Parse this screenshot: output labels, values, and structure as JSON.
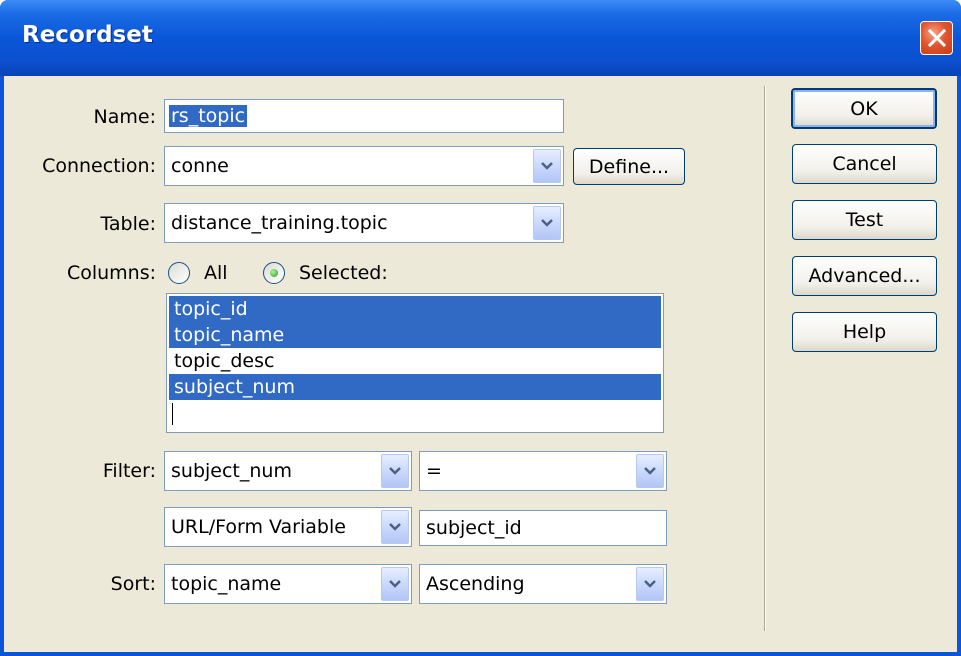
{
  "dialog": {
    "title": "Recordset"
  },
  "form": {
    "name_label": "Name:",
    "name_value": "rs_topic",
    "connection_label": "Connection:",
    "connection_value": "conne",
    "define_button": "Define...",
    "table_label": "Table:",
    "table_value": "distance_training.topic",
    "columns_label": "Columns:",
    "radio_all": "All",
    "radio_selected": "Selected:",
    "columns_selected_option": "Selected",
    "columns": [
      {
        "label": "topic_id",
        "selected": true
      },
      {
        "label": "topic_name",
        "selected": true
      },
      {
        "label": "topic_desc",
        "selected": false
      },
      {
        "label": "subject_num",
        "selected": true
      }
    ],
    "filter_label": "Filter:",
    "filter_column": "subject_num",
    "filter_operator": "=",
    "filter_source": "URL/Form Variable",
    "filter_value": "subject_id",
    "sort_label": "Sort:",
    "sort_column": "topic_name",
    "sort_order": "Ascending"
  },
  "buttons": {
    "ok": "OK",
    "cancel": "Cancel",
    "test": "Test",
    "advanced": "Advanced...",
    "help": "Help"
  },
  "colors": {
    "titlebar": "#0a56d9",
    "dialog_bg": "#ece9d8",
    "selection": "#316ac5",
    "close_button": "#e0552f"
  },
  "icons": {
    "close": "close-x-icon",
    "dropdown": "chevron-down-icon"
  }
}
